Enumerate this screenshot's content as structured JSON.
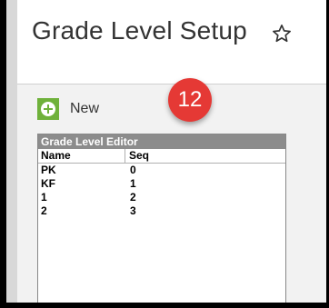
{
  "header": {
    "title": "Grade Level Setup"
  },
  "toolbar": {
    "new_label": "New"
  },
  "step_badge": "12",
  "editor": {
    "title": "Grade Level Editor",
    "columns": [
      "Name",
      "Seq"
    ],
    "rows": [
      {
        "name": "PK",
        "seq": "0"
      },
      {
        "name": "KF",
        "seq": "1"
      },
      {
        "name": "1",
        "seq": "2"
      },
      {
        "name": "2",
        "seq": "3"
      }
    ]
  },
  "colors": {
    "new_button": "#6fb13b",
    "badge": "#e53935",
    "editor_title_bar": "#8c8c8c"
  }
}
